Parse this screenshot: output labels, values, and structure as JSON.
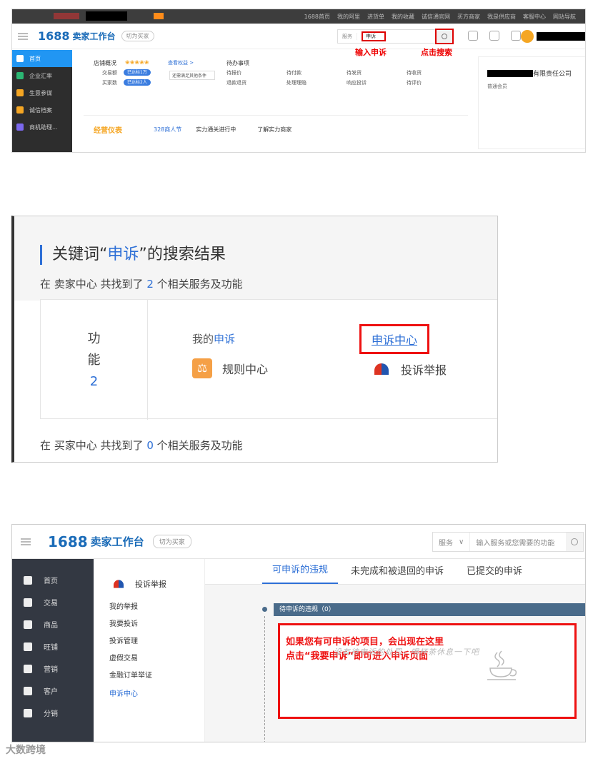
{
  "screen1": {
    "topbar": [
      "1688首页",
      "我的阿里",
      "进货单",
      "我的收藏",
      "诚信通官网",
      "买方商家",
      "我是供应商",
      "客服中心",
      "网站导航"
    ],
    "logo": "1688",
    "workbench": "卖家工作台",
    "switch_label": "切为买家",
    "search_category": "服务",
    "search_value": "申诉",
    "annotation_input": "输入申诉",
    "annotation_search": "点击搜索",
    "sidebar": [
      "首页",
      "企业汇率",
      "生意参谋",
      "诚信档案",
      "商机助理..."
    ],
    "shop_label": "店铺概况",
    "upgrade_label": "查看权益 >",
    "trade_label": "交易额",
    "buyer_label": "买家数",
    "trade_pill": "已达标1万",
    "buyer_pill": "已达标2人",
    "hint": "还需满足其他条件",
    "todo_title": "待办事项",
    "todo_items": [
      "待报价",
      "待付款",
      "待发货",
      "待收货",
      "退款退货",
      "处理理赔",
      "响应投诉",
      "待评价"
    ],
    "card_title": "经营仪表",
    "card_count": "328商人节",
    "card_text": "实力通关进行中",
    "card_more": "了解实力商家",
    "company": "有限责任公司",
    "member": "普通会员"
  },
  "screen2": {
    "title_prefix": "关键词“",
    "keyword": "申诉",
    "title_suffix": "”的搜索结果",
    "seller_prefix": "在 卖家中心 共找到了 ",
    "seller_count": "2",
    "seller_suffix": " 个相关服务及功能",
    "func_label": [
      "功",
      "能"
    ],
    "func_count": "2",
    "my_prefix": "我的",
    "my_kw": "申诉",
    "appeal_center": "申诉中心",
    "rule_center": "规则中心",
    "complaint": "投诉举报",
    "buyer_prefix": "在 买家中心 共找到了 ",
    "buyer_count": "0",
    "buyer_suffix": " 个相关服务及功能"
  },
  "screen3": {
    "logo": "1688",
    "workbench": "卖家工作台",
    "switch_label": "切为买家",
    "search_category": "服务",
    "search_placeholder": "输入服务或您需要的功能",
    "sidebar": [
      "首页",
      "交易",
      "商品",
      "旺铺",
      "营销",
      "客户",
      "分销"
    ],
    "nav_head": "投诉举报",
    "nav_items": [
      "我的举报",
      "我要投诉",
      "投诉管理",
      "虚假交易",
      "金融订单举证",
      "申诉中心"
    ],
    "tabs": [
      "可申诉的违规",
      "未完成和被退回的申诉",
      "已提交的申诉"
    ],
    "bar_label": "待申诉的违规（0）",
    "callout_line1": "如果您有可申诉的项目，会出现在这里",
    "callout_line2": "点击“我要申诉”即可进入申诉页面",
    "empty_text": "没有待申诉的处罚，喝杯茶休息一下吧"
  },
  "watermark": "大数跨境"
}
